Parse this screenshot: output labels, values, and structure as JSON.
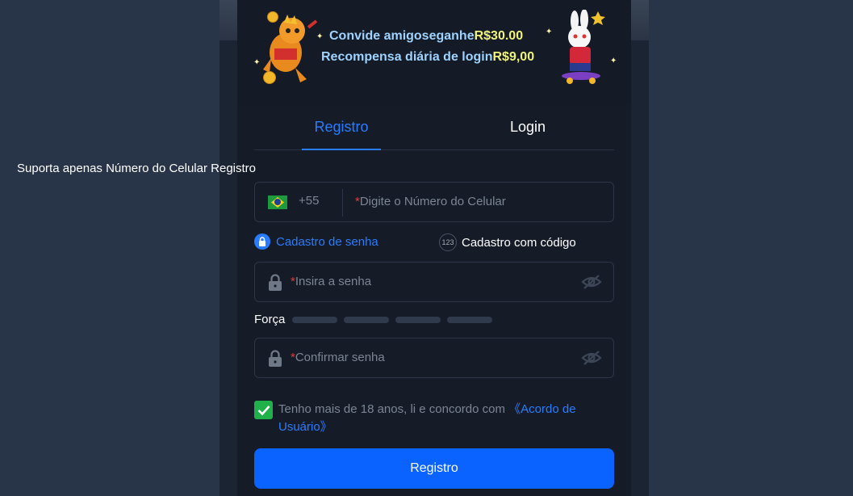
{
  "banner": {
    "line1_text": "Convide amigoseganhe",
    "line1_amount": "R$30.00",
    "line2_text": "Recompensa diária de login",
    "line2_amount": "R$9,00"
  },
  "tabs": [
    {
      "label": "Registro",
      "active": true
    },
    {
      "label": "Login",
      "active": false
    }
  ],
  "form": {
    "support_text": "Suporta apenas Número do Celular Registro",
    "country_code": "+55",
    "phone_placeholder": "Digite o Número do Celular",
    "required_mark": "*",
    "mode_password": "Cadastro de senha",
    "mode_code": "Cadastro com código",
    "code_badge": "123",
    "password_placeholder": "Insira a senha",
    "strength_label": "Força",
    "strength_level": 0,
    "confirm_placeholder": "Confirmar senha",
    "terms_text": "Tenho mais de 18 anos, li e concordo com ",
    "terms_link": "《Acordo de Usuário》",
    "terms_checked": true,
    "submit_label": "Registro"
  },
  "colors": {
    "accent": "#2a7cff",
    "button": "#0b63ff",
    "checkbox": "#20b14a",
    "modal_bg": "#151c28",
    "page_bg": "#283447"
  }
}
